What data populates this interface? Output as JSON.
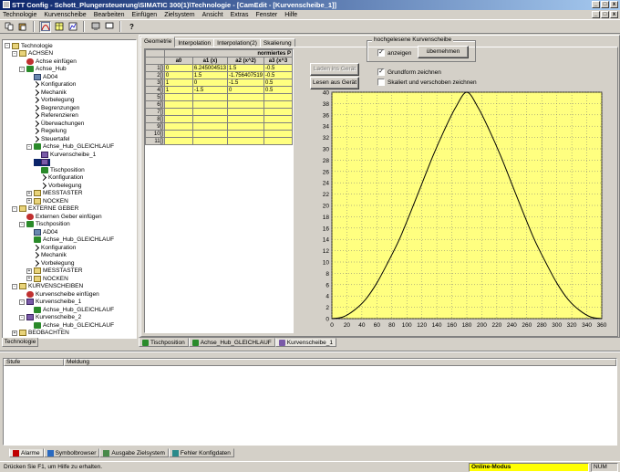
{
  "title": "STT Config - Schott_Plungersteuerung\\SIMATIC 300(1)\\Technologie - [CamEdit - [Kurvenscheibe_1]]",
  "window_controls": [
    "_",
    "□",
    "x"
  ],
  "menu": [
    "Technologie",
    "Kurvenscheibe",
    "Bearbeiten",
    "Einfügen",
    "Zielsystem",
    "Ansicht",
    "Extras",
    "Fenster",
    "Hilfe"
  ],
  "tree": {
    "items": [
      {
        "text": "Technologie",
        "icon": "folder",
        "indent": 0,
        "exp": "-"
      },
      {
        "text": "ACHSEN",
        "icon": "folder",
        "indent": 1,
        "exp": "-"
      },
      {
        "text": "Achse einfügen",
        "icon": "gear",
        "indent": 2,
        "exp": ""
      },
      {
        "text": "Achse_Hub",
        "icon": "axis",
        "indent": 2,
        "exp": "-"
      },
      {
        "text": "AD04",
        "icon": "drive",
        "indent": 3,
        "exp": ""
      },
      {
        "text": "Konfiguration",
        "icon": "arrow",
        "indent": 3,
        "exp": ""
      },
      {
        "text": "Mechanik",
        "icon": "arrow",
        "indent": 3,
        "exp": ""
      },
      {
        "text": "Vorbelegung",
        "icon": "arrow",
        "indent": 3,
        "exp": ""
      },
      {
        "text": "Begrenzungen",
        "icon": "arrow",
        "indent": 3,
        "exp": ""
      },
      {
        "text": "Referenzieren",
        "icon": "arrow",
        "indent": 3,
        "exp": ""
      },
      {
        "text": "Überwachungen",
        "icon": "arrow",
        "indent": 3,
        "exp": ""
      },
      {
        "text": "Regelung",
        "icon": "arrow",
        "indent": 3,
        "exp": ""
      },
      {
        "text": "Steuertafel",
        "icon": "arrow",
        "indent": 3,
        "exp": ""
      },
      {
        "text": "Achse_Hub_GLEICHLAUF",
        "icon": "axis",
        "indent": 3,
        "exp": "-"
      },
      {
        "text": "Kurvenscheibe_1",
        "icon": "cam",
        "indent": 4,
        "exp": ""
      },
      {
        "text": "",
        "icon": "cam",
        "indent": 4,
        "exp": "",
        "selected": true
      },
      {
        "text": "Tischposition",
        "icon": "axis",
        "indent": 4,
        "exp": ""
      },
      {
        "text": "Konfiguration",
        "icon": "arrow",
        "indent": 4,
        "exp": ""
      },
      {
        "text": "Vorbelegung",
        "icon": "arrow",
        "indent": 4,
        "exp": ""
      },
      {
        "text": "MESSTASTER",
        "icon": "folder",
        "indent": 3,
        "exp": "+"
      },
      {
        "text": "NOCKEN",
        "icon": "folder",
        "indent": 3,
        "exp": "+"
      },
      {
        "text": "EXTERNE GEBER",
        "icon": "folder",
        "indent": 1,
        "exp": "-"
      },
      {
        "text": "Externen Geber einfügen",
        "icon": "gear",
        "indent": 2,
        "exp": ""
      },
      {
        "text": "Tischposition",
        "icon": "axis",
        "indent": 2,
        "exp": "-"
      },
      {
        "text": "AD04",
        "icon": "drive",
        "indent": 3,
        "exp": ""
      },
      {
        "text": "Achse_Hub_GLEICHLAUF",
        "icon": "axis",
        "indent": 3,
        "exp": ""
      },
      {
        "text": "Konfiguration",
        "icon": "arrow",
        "indent": 3,
        "exp": ""
      },
      {
        "text": "Mechanik",
        "icon": "arrow",
        "indent": 3,
        "exp": ""
      },
      {
        "text": "Vorbelegung",
        "icon": "arrow",
        "indent": 3,
        "exp": ""
      },
      {
        "text": "MESSTASTER",
        "icon": "folder",
        "indent": 3,
        "exp": "+"
      },
      {
        "text": "NOCKEN",
        "icon": "folder",
        "indent": 3,
        "exp": "+"
      },
      {
        "text": "KURVENSCHEIBEN",
        "icon": "folder",
        "indent": 1,
        "exp": "-"
      },
      {
        "text": "Kurvenscheibe einfügen",
        "icon": "gear",
        "indent": 2,
        "exp": ""
      },
      {
        "text": "Kurvenscheibe_1",
        "icon": "cam",
        "indent": 2,
        "exp": "-"
      },
      {
        "text": "Achse_Hub_GLEICHLAUF",
        "icon": "axis",
        "indent": 3,
        "exp": ""
      },
      {
        "text": "Kurvenscheibe_2",
        "icon": "cam",
        "indent": 2,
        "exp": "-"
      },
      {
        "text": "Achse_Hub_GLEICHLAUF",
        "icon": "axis",
        "indent": 3,
        "exp": ""
      },
      {
        "text": "BEOBACHTEN",
        "icon": "folder",
        "indent": 1,
        "exp": "+"
      }
    ],
    "bottom_tab": "Technologie"
  },
  "editor": {
    "tabs": [
      "Geometrie",
      "Interpolation",
      "Interpolation(2)",
      "Skalierung"
    ],
    "active_tab": 0,
    "grid": {
      "group_header": "normiertes P",
      "columns": [
        "a0",
        "a1 (x)",
        "a2 (x^2)",
        "a3 (x^3"
      ],
      "rows": [
        {
          "label": "1[",
          "btn": "]",
          "cells": [
            "0",
            "6.245004513",
            "1.5",
            "-0.5"
          ]
        },
        {
          "label": "2[",
          "btn": "]",
          "cells": [
            "0",
            "1.5",
            "-1.756407519",
            "-0.5"
          ]
        },
        {
          "label": "3[",
          "btn": "]",
          "cells": [
            "1",
            "0",
            "-1.5",
            "0.5"
          ]
        },
        {
          "label": "4[",
          "btn": "]",
          "cells": [
            "1",
            "-1.5",
            "0",
            "0.5"
          ]
        },
        {
          "label": "5[",
          "btn": "]",
          "cells": [
            "",
            "",
            "",
            ""
          ]
        },
        {
          "label": "6[",
          "btn": "]",
          "cells": [
            "",
            "",
            "",
            ""
          ]
        },
        {
          "label": "7[",
          "btn": "]",
          "cells": [
            "",
            "",
            "",
            ""
          ]
        },
        {
          "label": "8[",
          "btn": "]",
          "cells": [
            "",
            "",
            "",
            ""
          ]
        },
        {
          "label": "9[",
          "btn": "]",
          "cells": [
            "",
            "",
            "",
            ""
          ]
        },
        {
          "label": "10[",
          "btn": "]",
          "cells": [
            "",
            "",
            "",
            ""
          ]
        },
        {
          "label": "11[",
          "btn": "]",
          "cells": [
            "",
            "",
            "",
            ""
          ]
        }
      ]
    },
    "buttons": {
      "load_to_device": "Laden ins Gerät",
      "read_from_device": "Lesen aus Gerät"
    },
    "group": {
      "label": "hochgelesene Kurvenscheibe",
      "show_label": "anzeigen",
      "show_checked": true,
      "apply": "übernehmen"
    },
    "options": {
      "draw_base": "Grundform zeichnen",
      "draw_base_checked": true,
      "draw_scaled": "Skaliert und verschoben zeichnen",
      "draw_scaled_checked": false
    }
  },
  "chart_data": {
    "type": "line",
    "x": [
      0,
      15,
      30,
      45,
      60,
      75,
      90,
      105,
      120,
      135,
      150,
      165,
      180,
      195,
      210,
      225,
      240,
      255,
      270,
      285,
      300,
      315,
      330,
      345,
      360
    ],
    "y": [
      0,
      0.3,
      1.5,
      3.4,
      6.3,
      10,
      14,
      18.8,
      23.8,
      28.8,
      33.3,
      37.3,
      40,
      37.3,
      33.3,
      28.8,
      23.8,
      18.8,
      14,
      10,
      6.3,
      3.4,
      1.5,
      0.3,
      0
    ],
    "xticks": [
      0,
      20,
      40,
      60,
      80,
      100,
      120,
      140,
      160,
      180,
      200,
      220,
      240,
      260,
      280,
      300,
      320,
      340,
      360
    ],
    "yticks": [
      0,
      2,
      4,
      6,
      8,
      10,
      12,
      14,
      16,
      18,
      20,
      22,
      24,
      26,
      28,
      30,
      32,
      34,
      36,
      38,
      40
    ],
    "xlim": [
      0,
      360
    ],
    "ylim": [
      0,
      40
    ],
    "grid": true,
    "background": "#ffff80",
    "line_color": "#000000"
  },
  "doc_tabs": [
    {
      "label": "Tischposition",
      "active": false
    },
    {
      "label": "Achse_Hub_GLEICHLAUF",
      "active": false
    },
    {
      "label": "Kurvenscheibe_1",
      "active": true
    }
  ],
  "messages": {
    "columns": [
      "Stufe",
      "Meldung"
    ]
  },
  "bottom_tabs": [
    {
      "label": "Alarme",
      "icon": "alarm-icon",
      "active": true
    },
    {
      "label": "Symbolbrowser",
      "icon": "symbol-icon",
      "active": false
    },
    {
      "label": "Ausgabe Zielsystem",
      "icon": "output-icon",
      "active": false
    },
    {
      "label": "Fehler Konfigdaten",
      "icon": "error-icon",
      "active": false
    }
  ],
  "status": {
    "hint": "Drücken Sie F1, um Hilfe zu erhalten.",
    "mode": "Online-Modus",
    "num": "NUM"
  },
  "colors": {
    "mode_bg": "#ffff00",
    "titlebar": "#0a246a",
    "grid_cell": "#ffff80"
  }
}
